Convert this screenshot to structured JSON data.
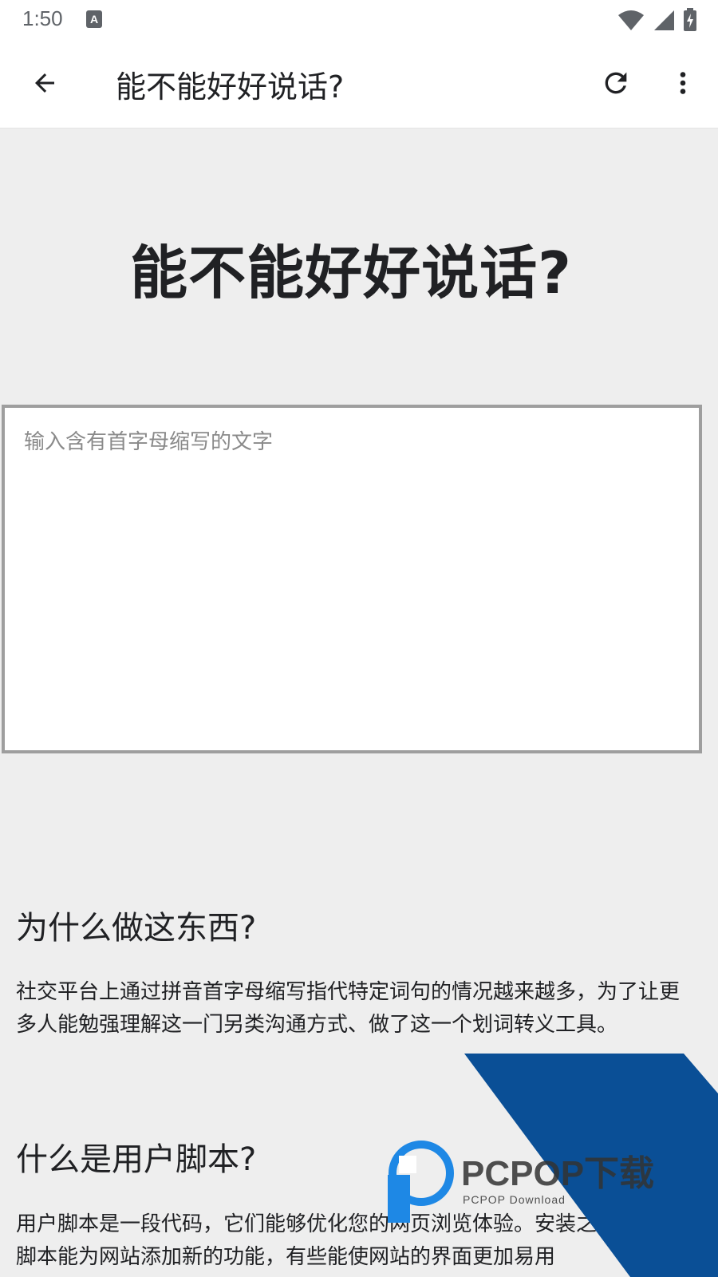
{
  "status_bar": {
    "time": "1:50",
    "notification_icon": "a-icon"
  },
  "app_bar": {
    "title": "能不能好好说话?",
    "back_icon": "arrow-left-icon",
    "reload_icon": "reload-icon",
    "more_icon": "more-vert-icon"
  },
  "main": {
    "hero_title": "能不能好好说话?",
    "input_placeholder": "输入含有首字母缩写的文字",
    "input_value": "",
    "section1": {
      "heading": "为什么做这东西?",
      "text": "社交平台上通过拼音首字母缩写指代特定词句的情况越来越多，为了让更多人能勉强理解这一门另类沟通方式、做了这一个划词转义工具。"
    },
    "section2": {
      "heading": "什么是用户脚本?",
      "text": "用户脚本是一段代码，它们能够优化您的网页浏览体验。安装之后，有些脚本能为网站添加新的功能，有些能使网站的界面更加易用"
    }
  },
  "watermark": {
    "brand": "PCPOP下载",
    "sub": "PCPOP Download",
    "color_blue": "#0a4f96"
  }
}
